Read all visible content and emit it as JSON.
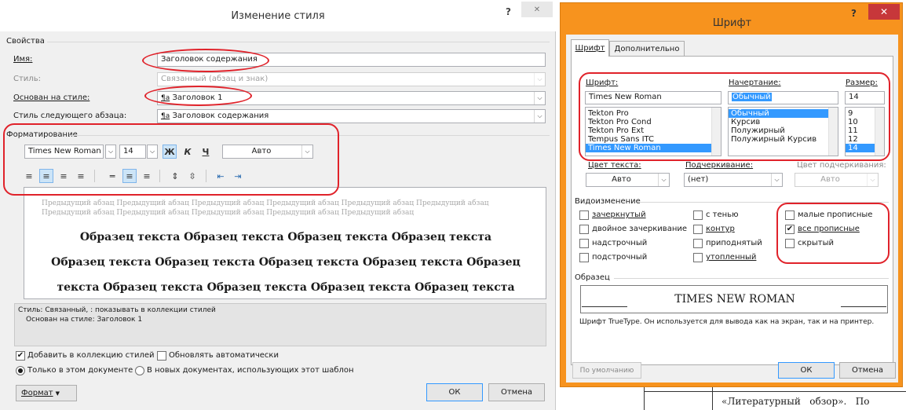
{
  "style_dialog": {
    "title": "Изменение стиля",
    "properties_group": "Свойства",
    "name_label": "Имя:",
    "name_value": "Заголовок содержания",
    "style_type_label": "Стиль:",
    "style_type_value": "Связанный (абзац и знак)",
    "based_on_label": "Основан на стиле:",
    "based_on_value": "Заголовок 1",
    "next_style_label": "Стиль следующего абзаца:",
    "next_style_value": "Заголовок содержания",
    "formatting_group": "Форматирование",
    "font_value": "Times New Roman",
    "size_value": "14",
    "bold_glyph": "Ж",
    "italic_glyph": "К",
    "underline_glyph": "Ч",
    "color_value": "Авто",
    "preview_prev_para": "Предыдущий абзац Предыдущий абзац Предыдущий абзац Предыдущий абзац Предыдущий абзац Предыдущий абзац Предыдущий абзац Предыдущий абзац Предыдущий абзац Предыдущий абзац Предыдущий абзац",
    "preview_line_1": "Образец текста Образец текста Образец текста Образец текста",
    "preview_line_2": "Образец текста Образец текста Образец текста Образец текста Образец",
    "preview_line_3": "текста Образец текста Образец текста Образец текста Образец текста",
    "description_line_1": "Стиль: Связанный, : показывать в коллекции стилей",
    "description_line_2": "Основан на стиле: Заголовок 1",
    "add_to_gallery_label": "Добавить в коллекцию стилей",
    "auto_update_label": "Обновлять автоматически",
    "this_doc_label": "Только в этом документе",
    "new_docs_label": "В новых документах, использующих этот шаблон",
    "format_button": "Формат",
    "ok_button": "ОК",
    "cancel_button": "Отмена",
    "help_glyph": "?",
    "close_glyph": "✕"
  },
  "font_dialog": {
    "title": "Шрифт",
    "tabs": [
      "Шрифт",
      "Дополнительно"
    ],
    "font_label": "Шрифт:",
    "font_value": "Times New Roman",
    "font_list": [
      "Tekton Pro",
      "Tekton Pro Cond",
      "Tekton Pro Ext",
      "Tempus Sans ITC",
      "Times New Roman"
    ],
    "style_label": "Начертание:",
    "style_value": "Обычный",
    "style_list": [
      "Обычный",
      "Курсив",
      "Полужирный",
      "Полужирный Курсив"
    ],
    "size_label": "Размер:",
    "size_value": "14",
    "size_list": [
      "9",
      "10",
      "11",
      "12",
      "14"
    ],
    "text_color_label": "Цвет текста:",
    "text_color_value": "Авто",
    "underline_label": "Подчеркивание:",
    "underline_value": "(нет)",
    "underline_color_label": "Цвет подчеркивания:",
    "underline_color_value": "Авто",
    "effects_group": "Видоизменение",
    "effects": {
      "strikethrough": "зачеркнутый",
      "double_strikethrough": "двойное зачеркивание",
      "superscript": "надстрочный",
      "subscript": "подстрочный",
      "shadow": "с тенью",
      "outline": "контур",
      "emboss": "приподнятый",
      "engrave": "утопленный",
      "small_caps": "малые прописные",
      "all_caps": "все прописные",
      "hidden": "скрытый"
    },
    "all_caps_checked": true,
    "sample_group": "Образец",
    "sample_text": "TIMES NEW ROMAN",
    "sample_note": "Шрифт TrueType. Он используется для вывода как на экран, так и на принтер.",
    "default_button": "По умолчанию",
    "ok_button": "ОК",
    "cancel_button": "Отмена",
    "help_glyph": "?",
    "close_glyph": "✕"
  },
  "background_doc": {
    "bottom_text": "«Литературный   обзор».   По"
  },
  "colors": {
    "title_bar_style": "#ffffff",
    "title_bar_font": "#f7931e",
    "annotation_red": "#e0222a",
    "close_red": "#c7373a",
    "selection_blue": "#3399ff"
  }
}
